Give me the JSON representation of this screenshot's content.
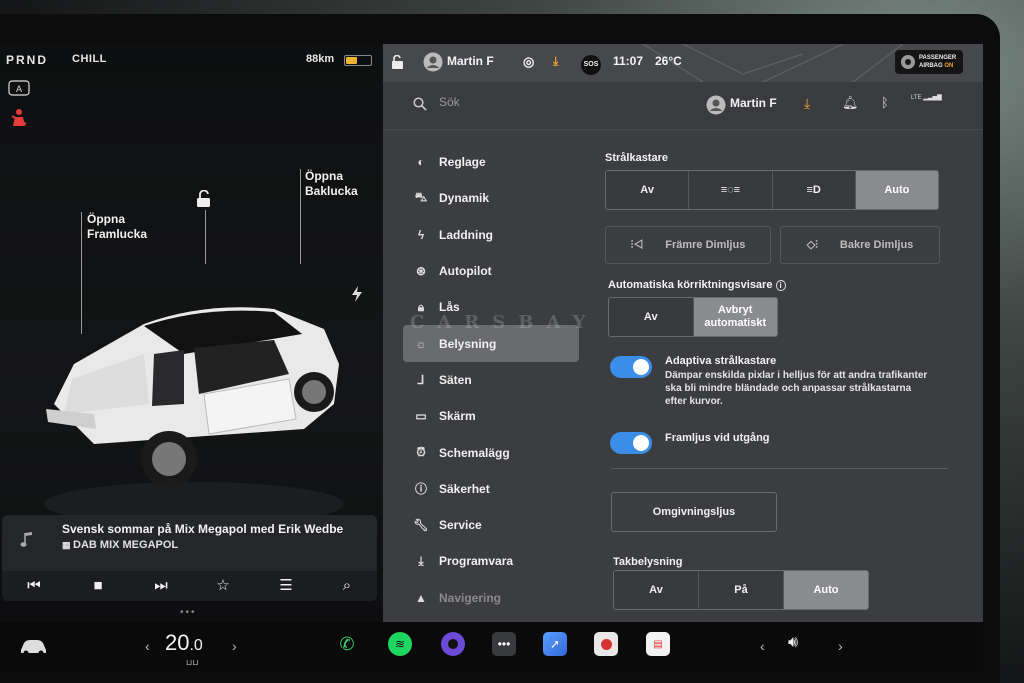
{
  "drive": {
    "gears": "PRND",
    "mode": "CHILL",
    "range": "88km",
    "battery_level": 0.45
  },
  "car_panel": {
    "door_front": [
      "Öppna",
      "Framlucka"
    ],
    "door_rear": [
      "Öppna",
      "Baklucka"
    ]
  },
  "media": {
    "title": "Svensk sommar på Mix Megapol med Erik Wedbe",
    "station": "DAB MIX MEGAPOL"
  },
  "status_bar": {
    "user": "Martin F",
    "time": "11:07",
    "outside_temp": "26°C",
    "sos": "SOS",
    "airbag_line1": "PASSENGER",
    "airbag_line2": "AIRBAG",
    "airbag_state": "ON"
  },
  "search": {
    "placeholder": "Sök",
    "user": "Martin F",
    "lte": "LTE"
  },
  "nav": {
    "items": [
      {
        "label": "Reglage",
        "icon": "toggle-icon"
      },
      {
        "label": "Dynamik",
        "icon": "car-icon"
      },
      {
        "label": "Laddning",
        "icon": "bolt-icon"
      },
      {
        "label": "Autopilot",
        "icon": "steering-wheel-icon"
      },
      {
        "label": "Lås",
        "icon": "lock-icon"
      },
      {
        "label": "Belysning",
        "icon": "light-bulb-icon"
      },
      {
        "label": "Säten",
        "icon": "seat-icon"
      },
      {
        "label": "Skärm",
        "icon": "display-icon"
      },
      {
        "label": "Schemalägg",
        "icon": "alarm-clock-icon"
      },
      {
        "label": "Säkerhet",
        "icon": "info-icon"
      },
      {
        "label": "Service",
        "icon": "wrench-icon"
      },
      {
        "label": "Programvara",
        "icon": "download-icon"
      },
      {
        "label": "Navigering",
        "icon": "navigation-icon"
      }
    ],
    "active_index": 5
  },
  "headlights": {
    "title": "Strålkastare",
    "options": [
      "Av",
      "",
      "",
      "Auto"
    ],
    "selected": "Auto"
  },
  "fog": {
    "front": "Främre Dimljus",
    "rear": "Bakre Dimljus"
  },
  "auto_indicators": {
    "title": "Automatiska körriktningsvisare",
    "options": [
      "Av",
      "Avbryt automatiskt"
    ],
    "selected": "Avbryt automatiskt"
  },
  "adaptive": {
    "title": "Adaptiva strålkastare",
    "desc": "Dämpar enskilda pixlar i helljus för att andra trafikanter ska bli mindre bländade och anpassar strålkastarna efter kurvor.",
    "enabled": true
  },
  "exit_lights": {
    "title": "Framljus vid utgång",
    "enabled": true
  },
  "ambient": {
    "label": "Omgivningsljus"
  },
  "ceiling": {
    "title": "Takbelysning",
    "options": [
      "Av",
      "På",
      "Auto"
    ],
    "selected": "Auto"
  },
  "dock": {
    "temp_whole": "20",
    "temp_decimal": ".0"
  },
  "watermark": "CARSBAY",
  "colors": {
    "accent_toggle": "#3a8ee8",
    "download_orange": "#f2a332",
    "battery_yellow": "#f2b233"
  }
}
